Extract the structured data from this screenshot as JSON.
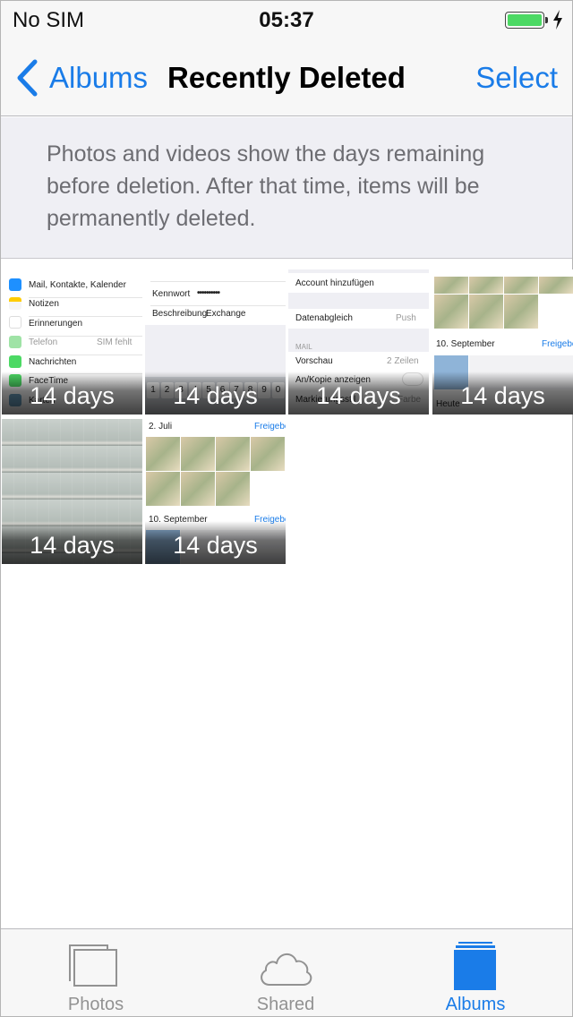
{
  "status_bar": {
    "carrier": "No SIM",
    "time": "05:37",
    "battery_level": 1.0,
    "charging": true,
    "battery_color": "#4cd964"
  },
  "nav": {
    "back_label": "Albums",
    "title": "Recently Deleted",
    "select_label": "Select",
    "accent_color": "#1a7ce8"
  },
  "info": {
    "text": "Photos and videos show the days remaining before deletion. After that time, items will be permanently deleted."
  },
  "thumbnails": [
    {
      "days_label": "14 days",
      "content": "settings-list",
      "rows": [
        {
          "label": "Mail, Kontakte, Kalender",
          "value": ""
        },
        {
          "label": "Notizen",
          "value": ""
        },
        {
          "label": "Erinnerungen",
          "value": ""
        },
        {
          "label": "Telefon",
          "value": "SIM fehlt"
        },
        {
          "label": "Nachrichten",
          "value": ""
        },
        {
          "label": "FaceTime",
          "value": ""
        },
        {
          "label": "Karten",
          "value": ""
        }
      ]
    },
    {
      "days_label": "14 days",
      "content": "exchange-form",
      "password_label": "Kennwort",
      "password_mask": "••••••••••",
      "description_label": "Beschreibung",
      "description_value": "Exchange",
      "keys": [
        "1",
        "2",
        "3",
        "4",
        "5",
        "6",
        "7",
        "8",
        "9",
        "0"
      ]
    },
    {
      "days_label": "14 days",
      "content": "mail-settings",
      "rows": [
        {
          "label": "Account hinzufügen",
          "value": ""
        },
        {
          "label": "Datenabgleich",
          "value": "Push"
        },
        {
          "label": "MAIL",
          "value": ""
        },
        {
          "label": "Vorschau",
          "value": "2 Zeilen"
        },
        {
          "label": "An/Kopie anzeigen",
          "value": ""
        },
        {
          "label": "Markierungsstil",
          "value": "Farbe"
        }
      ]
    },
    {
      "days_label": "14 days",
      "content": "photo-moments",
      "section_date": "10. September",
      "share_label": "Freigeben",
      "footer_label": "Heute"
    },
    {
      "days_label": "14 days",
      "content": "building-facade"
    },
    {
      "days_label": "14 days",
      "content": "photo-moments",
      "section_date": "2. Juli",
      "share_label": "Freigeben",
      "second_date": "10. September"
    }
  ],
  "tabs": [
    {
      "label": "Photos",
      "icon": "photos-stack-icon",
      "active": false
    },
    {
      "label": "Shared",
      "icon": "cloud-icon",
      "active": false
    },
    {
      "label": "Albums",
      "icon": "albums-icon",
      "active": true
    }
  ]
}
